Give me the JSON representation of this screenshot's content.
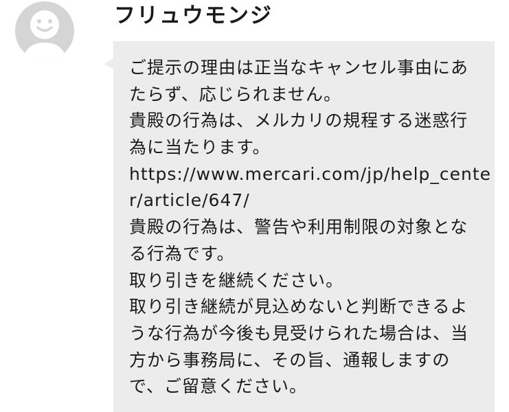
{
  "sender": {
    "name": "フリュウモンジ",
    "avatar_icon": "default-user-avatar-icon"
  },
  "message": {
    "lines": [
      "ご提示の理由は正当なキャンセル事由にあ",
      "たらず、応じられません。",
      "貴殿の行為は、メルカリの規程する迷惑行",
      "為に当たります。",
      "https://www.mercari.com/jp/help_cente",
      "r/article/647/",
      "貴殿の行為は、警告や利用制限の対象とな",
      "る行為です。",
      "取り引きを継続ください。",
      "取り引き継続が見込めないと判断できるよ",
      "うな行為が今後も見受けられた場合は、当",
      "方から事務局に、その旨、通報しますの",
      "で、ご留意ください。"
    ]
  },
  "colors": {
    "bubble_background": "#ececec",
    "avatar_background": "#d5d5d5",
    "avatar_figure": "#ffffff",
    "text": "#1a1a1a"
  }
}
